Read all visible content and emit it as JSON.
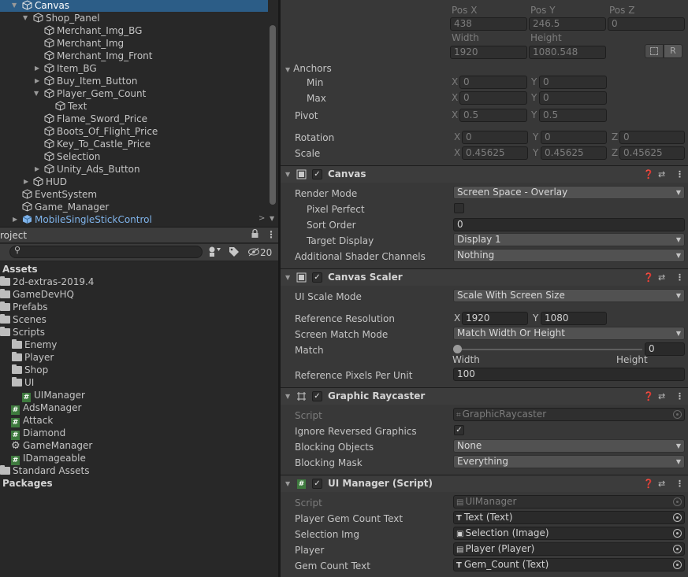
{
  "hierarchy": {
    "items": [
      {
        "label": "Canvas",
        "selected": true
      },
      {
        "label": "Shop_Panel"
      },
      {
        "label": "Merchant_Img_BG"
      },
      {
        "label": "Merchant_Img"
      },
      {
        "label": "Merchant_Img_Front"
      },
      {
        "label": "Item_BG"
      },
      {
        "label": "Buy_Item_Button"
      },
      {
        "label": "Player_Gem_Count"
      },
      {
        "label": "Text"
      },
      {
        "label": "Flame_Sword_Price"
      },
      {
        "label": "Boots_Of_Flight_Price"
      },
      {
        "label": "Key_To_Castle_Price"
      },
      {
        "label": "Selection"
      },
      {
        "label": "Unity_Ads_Button"
      },
      {
        "label": "HUD"
      },
      {
        "label": "EventSystem"
      },
      {
        "label": "Game_Manager"
      },
      {
        "label": "MobileSingleStickControl"
      }
    ]
  },
  "project": {
    "tab_label": "roject",
    "search_placeholder": "",
    "hidden_count": "20",
    "assets_header": "Assets",
    "items": [
      {
        "label": "2d-extras-2019.4"
      },
      {
        "label": "GameDevHQ"
      },
      {
        "label": "Prefabs"
      },
      {
        "label": "Scenes"
      },
      {
        "label": "Scripts"
      },
      {
        "label": "Enemy"
      },
      {
        "label": "Player"
      },
      {
        "label": "Shop"
      },
      {
        "label": "UI"
      },
      {
        "label": "UIManager"
      },
      {
        "label": "AdsManager"
      },
      {
        "label": "Attack"
      },
      {
        "label": "Diamond"
      },
      {
        "label": "GameManager"
      },
      {
        "label": "IDamageable"
      },
      {
        "label": "Standard Assets"
      }
    ],
    "packages_header": "Packages"
  },
  "rect_transform": {
    "pos_x_label": "Pos X",
    "pos_y_label": "Pos Y",
    "pos_z_label": "Pos Z",
    "pos_x": "438",
    "pos_y": "246.5",
    "pos_z": "0",
    "width_label": "Width",
    "height_label": "Height",
    "width": "1920",
    "height": "1080.548",
    "r_button": "R",
    "anchors_label": "Anchors",
    "min_label": "Min",
    "max_label": "Max",
    "min_x": "0",
    "min_y": "0",
    "max_x": "0",
    "max_y": "0",
    "pivot_label": "Pivot",
    "pivot_x": "0.5",
    "pivot_y": "0.5",
    "rotation_label": "Rotation",
    "rot_x": "0",
    "rot_y": "0",
    "rot_z": "0",
    "scale_label": "Scale",
    "scale_x": "0.45625",
    "scale_y": "0.45625",
    "scale_z": "0.45625",
    "x": "X",
    "y": "Y",
    "z": "Z"
  },
  "canvas": {
    "title": "Canvas",
    "render_mode_label": "Render Mode",
    "render_mode": "Screen Space - Overlay",
    "pixel_perfect_label": "Pixel Perfect",
    "sort_order_label": "Sort Order",
    "sort_order": "0",
    "target_display_label": "Target Display",
    "target_display": "Display 1",
    "shader_channels_label": "Additional Shader Channels",
    "shader_channels": "Nothing"
  },
  "canvas_scaler": {
    "title": "Canvas Scaler",
    "ui_scale_mode_label": "UI Scale Mode",
    "ui_scale_mode": "Scale With Screen Size",
    "ref_res_label": "Reference Resolution",
    "ref_x": "1920",
    "ref_y": "1080",
    "match_mode_label": "Screen Match Mode",
    "match_mode": "Match Width Or Height",
    "match_label": "Match",
    "match_value": "0",
    "match_fraction": 0,
    "width_label": "Width",
    "height_label": "Height",
    "ref_ppu_label": "Reference Pixels Per Unit",
    "ref_ppu": "100"
  },
  "graphic_raycaster": {
    "title": "Graphic Raycaster",
    "script_label": "Script",
    "script": "GraphicRaycaster",
    "ignore_reversed_label": "Ignore Reversed Graphics",
    "blocking_objects_label": "Blocking Objects",
    "blocking_objects": "None",
    "blocking_mask_label": "Blocking Mask",
    "blocking_mask": "Everything"
  },
  "ui_manager": {
    "title": "UI Manager (Script)",
    "script_label": "Script",
    "script": "UIManager",
    "gem_text_label": "Player Gem Count Text",
    "gem_text": "Text (Text)",
    "selection_img_label": "Selection Img",
    "selection_img": "Selection (Image)",
    "player_label": "Player",
    "player": "Player (Player)",
    "gem_count_label": "Gem Count Text",
    "gem_count": "Gem_Count (Text)"
  },
  "colors": {
    "selection": "#2c5d87",
    "prefab_blue": "#7fb3ea",
    "panel_bg": "#282828",
    "inspector_bg": "#383838"
  }
}
